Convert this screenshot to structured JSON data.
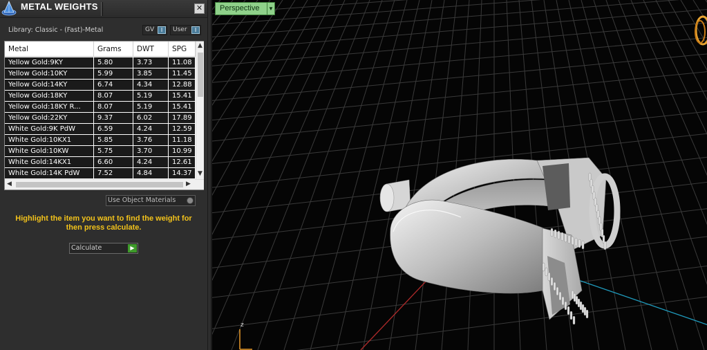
{
  "panel": {
    "title": "METAL WEIGHTS",
    "close_label": "✕",
    "library_label": "Library: Classic - (Fast)-Metal",
    "gv_label": "GV",
    "user_label": "User",
    "toggle_knob": "I",
    "use_object_materials": "Use Object Materials",
    "hint": "Highlight the item you want to find the weight for then press calculate.",
    "calculate_label": "Calculate"
  },
  "table": {
    "headers": [
      "Metal",
      "Grams",
      "DWT",
      "SPG"
    ],
    "rows": [
      [
        "Yellow Gold:9KY",
        "5.80",
        "3.73",
        "11.08"
      ],
      [
        "Yellow Gold:10KY",
        "5.99",
        "3.85",
        "11.45"
      ],
      [
        "Yellow Gold:14KY",
        "6.74",
        "4.34",
        "12.88"
      ],
      [
        "Yellow Gold:18KY",
        "8.07",
        "5.19",
        "15.41"
      ],
      [
        "Yellow Gold:18KY R...",
        "8.07",
        "5.19",
        "15.41"
      ],
      [
        "Yellow Gold:22KY",
        "9.37",
        "6.02",
        "17.89"
      ],
      [
        "White Gold:9K PdW",
        "6.59",
        "4.24",
        "12.59"
      ],
      [
        "White Gold:10KX1",
        "5.85",
        "3.76",
        "11.18"
      ],
      [
        "White Gold:10KW",
        "5.75",
        "3.70",
        "10.99"
      ],
      [
        "White Gold:14KX1",
        "6.60",
        "4.24",
        "12.61"
      ],
      [
        "White Gold:14K PdW",
        "7.52",
        "4.84",
        "14.37"
      ]
    ]
  },
  "viewport": {
    "view_label": "Perspective",
    "axis_z_label": "z"
  },
  "colors": {
    "hint": "#f2c21b",
    "perspective_bg": "#8fd18a",
    "calculate_go": "#3e9a2a"
  }
}
